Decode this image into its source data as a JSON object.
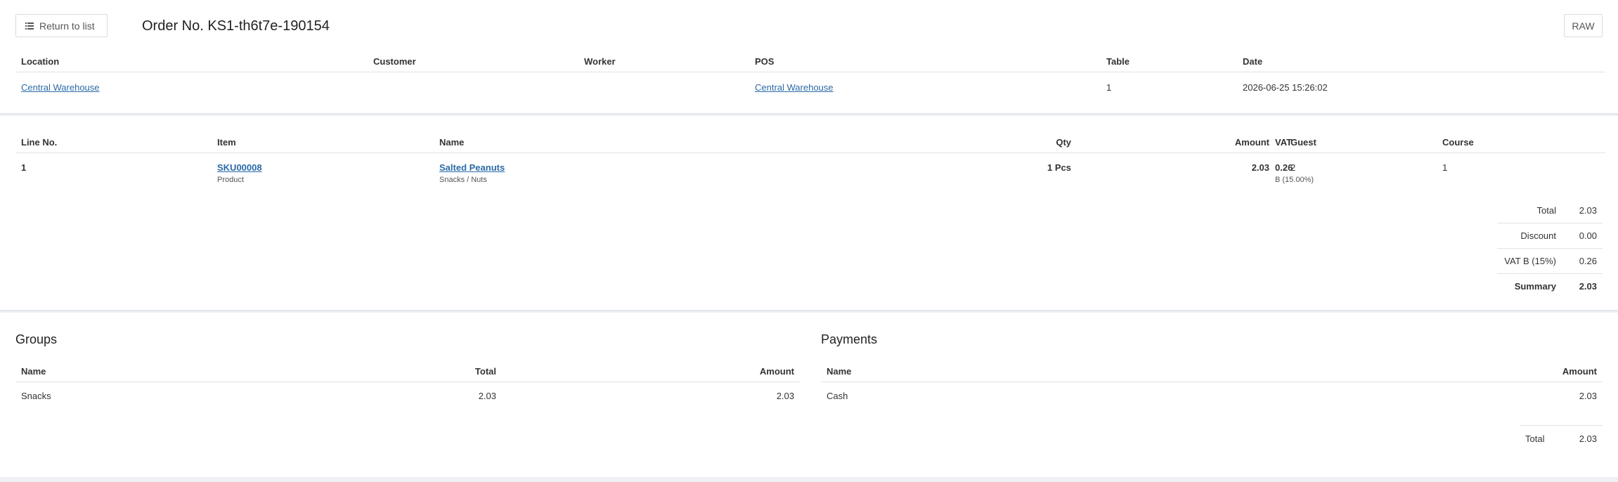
{
  "toolbar": {
    "return_label": "Return to list",
    "title": "Order No. KS1-th6t7e-190154",
    "raw_label": "RAW"
  },
  "order_info": {
    "headers": {
      "location": "Location",
      "customer": "Customer",
      "worker": "Worker",
      "pos": "POS",
      "table": "Table",
      "date": "Date"
    },
    "values": {
      "location": "Central Warehouse",
      "customer": "",
      "worker": "",
      "pos": "Central Warehouse",
      "table": "1",
      "date": "2026-06-25 15:26:02"
    }
  },
  "lines": {
    "headers": {
      "line_no": "Line No.",
      "item": "Item",
      "name": "Name",
      "qty": "Qty",
      "amount": "Amount",
      "vat": "VAT",
      "guest": "Guest",
      "course": "Course"
    },
    "rows": [
      {
        "line_no": "1",
        "item_code": "SKU00008",
        "item_type": "Product",
        "name": "Salted Peanuts",
        "category": "Snacks / Nuts",
        "qty": "1 Pcs",
        "amount": "2.03",
        "vat": "0.26",
        "vat_rate": "B (15.00%)",
        "guest": "2",
        "course": "1"
      }
    ]
  },
  "totals": {
    "total_label": "Total",
    "total_value": "2.03",
    "discount_label": "Discount",
    "discount_value": "0.00",
    "vat_label": "VAT B (15%)",
    "vat_value": "0.26",
    "summary_label": "Summary",
    "summary_value": "2.03"
  },
  "groups": {
    "title": "Groups",
    "headers": {
      "name": "Name",
      "total": "Total",
      "amount": "Amount"
    },
    "rows": [
      {
        "name": "Snacks",
        "total": "2.03",
        "amount": "2.03"
      }
    ]
  },
  "payments": {
    "title": "Payments",
    "headers": {
      "name": "Name",
      "amount": "Amount"
    },
    "rows": [
      {
        "name": "Cash",
        "amount": "2.03"
      }
    ],
    "total_label": "Total",
    "total_value": "2.03"
  }
}
